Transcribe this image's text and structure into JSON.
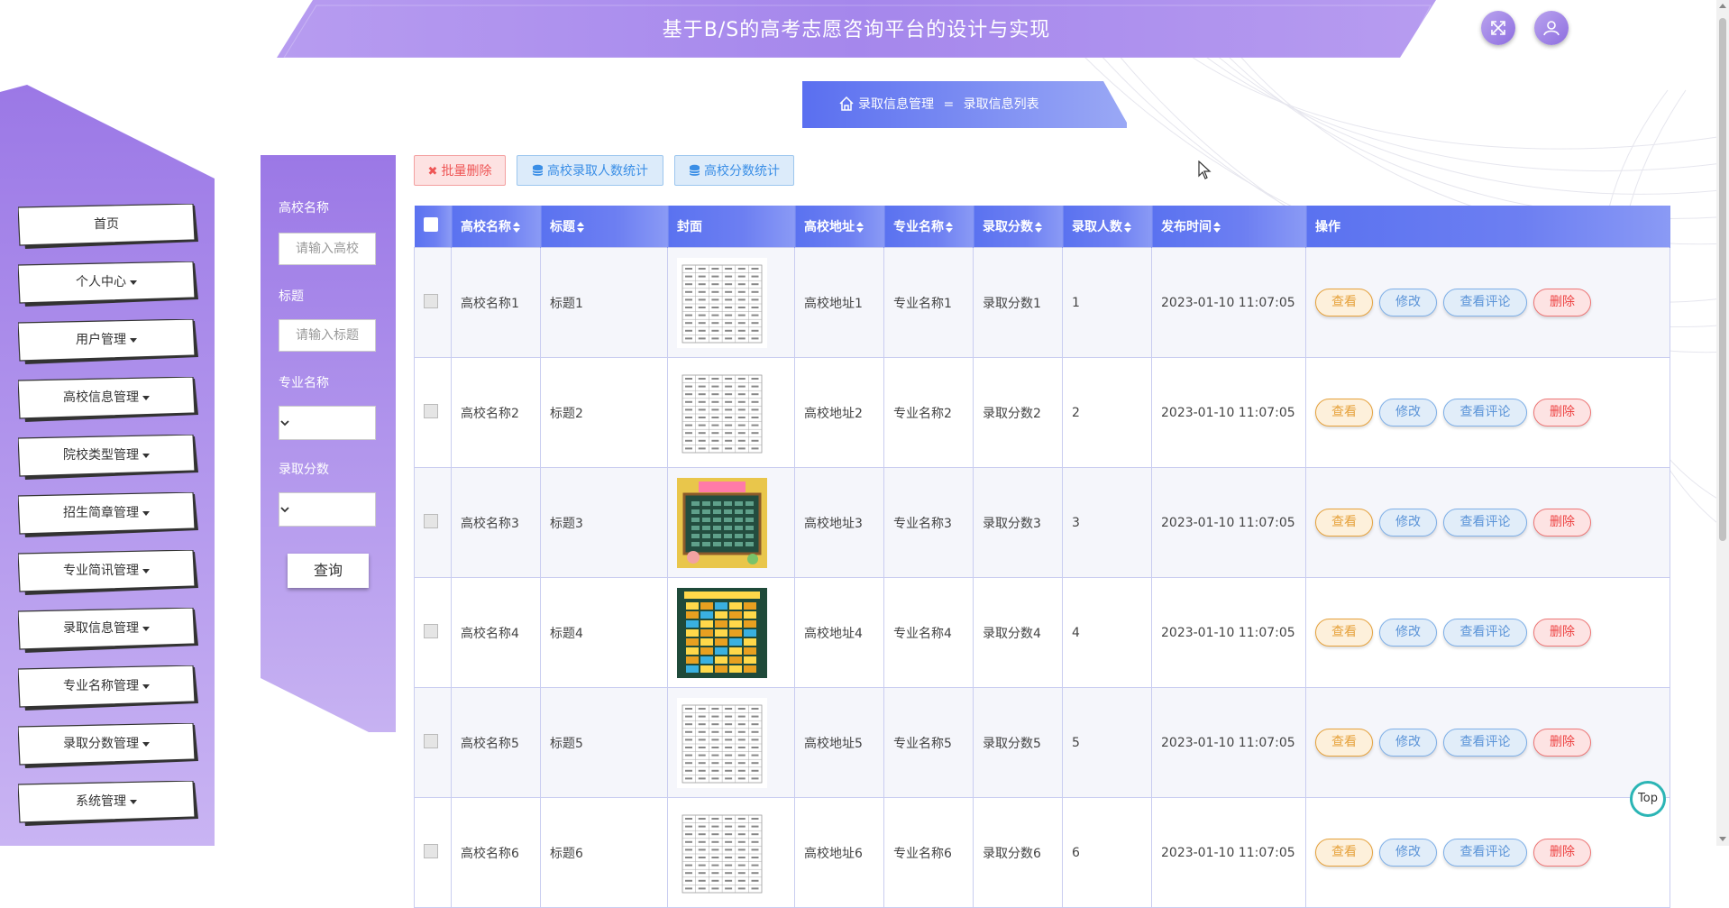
{
  "header": {
    "title": "基于B/S的高考志愿咨询平台的设计与实现"
  },
  "icons": {
    "fullscreen": "expand-icon",
    "user": "user-icon",
    "home": "home-icon"
  },
  "sidebar": {
    "items": [
      {
        "label": "首页",
        "dropdown": false
      },
      {
        "label": "个人中心",
        "dropdown": true
      },
      {
        "label": "用户管理",
        "dropdown": true
      },
      {
        "label": "高校信息管理",
        "dropdown": true
      },
      {
        "label": "院校类型管理",
        "dropdown": true
      },
      {
        "label": "招生简章管理",
        "dropdown": true
      },
      {
        "label": "专业简讯管理",
        "dropdown": true
      },
      {
        "label": "录取信息管理",
        "dropdown": true
      },
      {
        "label": "专业名称管理",
        "dropdown": true
      },
      {
        "label": "录取分数管理",
        "dropdown": true
      },
      {
        "label": "系统管理",
        "dropdown": true
      }
    ]
  },
  "breadcrumb": {
    "parent": "录取信息管理",
    "separator": "=",
    "current": "录取信息列表"
  },
  "search": {
    "school_label": "高校名称",
    "school_placeholder": "请输入高校",
    "title_label": "标题",
    "title_placeholder": "请输入标题",
    "major_label": "专业名称",
    "score_label": "录取分数",
    "query_button": "查询"
  },
  "toolbar": {
    "batch_delete": "批量删除",
    "stat_admit": "高校录取人数统计",
    "stat_score": "高校分数统计"
  },
  "table": {
    "columns": [
      "高校名称",
      "标题",
      "封面",
      "高校地址",
      "专业名称",
      "录取分数",
      "录取人数",
      "发布时间",
      "操作"
    ],
    "actions": {
      "view": "查看",
      "edit": "修改",
      "comments": "查看评论",
      "delete": "删除"
    },
    "rows": [
      {
        "school": "高校名称1",
        "title": "标题1",
        "address": "高校地址1",
        "major": "专业名称1",
        "score": "录取分数1",
        "count": "1",
        "time": "2023-01-10 11:07:05",
        "cover": "timetable-white"
      },
      {
        "school": "高校名称2",
        "title": "标题2",
        "address": "高校地址2",
        "major": "专业名称2",
        "score": "录取分数2",
        "count": "2",
        "time": "2023-01-10 11:07:05",
        "cover": "timetable-white"
      },
      {
        "school": "高校名称3",
        "title": "标题3",
        "address": "高校地址3",
        "major": "专业名称3",
        "score": "录取分数3",
        "count": "3",
        "time": "2023-01-10 11:07:05",
        "cover": "timetable-chalkboard"
      },
      {
        "school": "高校名称4",
        "title": "标题4",
        "address": "高校地址4",
        "major": "专业名称4",
        "score": "录取分数4",
        "count": "4",
        "time": "2023-01-10 11:07:05",
        "cover": "timetable-green"
      },
      {
        "school": "高校名称5",
        "title": "标题5",
        "address": "高校地址5",
        "major": "专业名称5",
        "score": "录取分数5",
        "count": "5",
        "time": "2023-01-10 11:07:05",
        "cover": "timetable-white"
      },
      {
        "school": "高校名称6",
        "title": "标题6",
        "address": "高校地址6",
        "major": "专业名称6",
        "score": "录取分数6",
        "count": "6",
        "time": "2023-01-10 11:07:05",
        "cover": "timetable-white"
      }
    ]
  },
  "scroll_top": {
    "label": "Top"
  },
  "colors": {
    "primary": "#5a72f0",
    "purple": "#9b7be6",
    "accent_orange": "#e6a23c",
    "accent_blue": "#5b94d8",
    "accent_red": "#e44",
    "teal": "#2bb5b5"
  }
}
